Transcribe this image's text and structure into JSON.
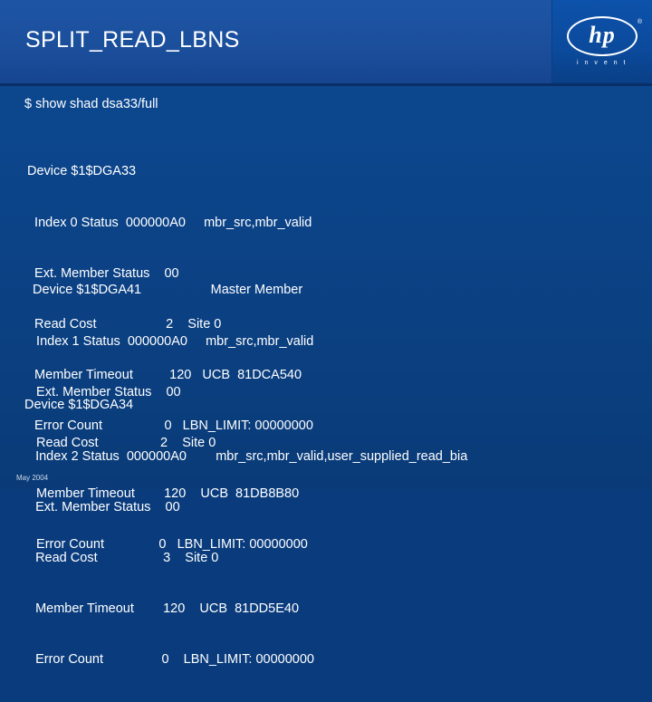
{
  "slide": {
    "title": "SPLIT_READ_LBNS",
    "prompt": "$ show shad dsa33/full",
    "footer_date": "May 2004",
    "logo": {
      "wordmark": "hp",
      "registered": "®",
      "tagline": "i n v e n t"
    },
    "blocks": [
      {
        "name": "device-dga33-block",
        "lines": [
          "Device $1$DGA33",
          "  Index 0 Status  000000A0     mbr_src,mbr_valid",
          "  Ext. Member Status    00",
          "  Read Cost                   2    Site 0",
          "  Member Timeout          120   UCB  81DCA540",
          "  Error Count                 0   LBN_LIMIT: 00000000"
        ]
      },
      {
        "name": "device-dga41-block",
        "lines": [
          " Device $1$DGA41                   Master Member",
          "  Index 1 Status  000000A0     mbr_src,mbr_valid",
          "  Ext. Member Status    00",
          "  Read Cost                 2    Site 0",
          "  Member Timeout        120    UCB  81DB8B80",
          "  Error Count               0   LBN_LIMIT: 00000000"
        ]
      },
      {
        "name": "device-dga34-block",
        "lines": [
          "Device $1$DGA34",
          "   Index 2 Status  000000A0        mbr_src,mbr_valid,user_supplied_read_bia",
          "   Ext. Member Status    00",
          "   Read Cost                  3    Site 0",
          "   Member Timeout        120    UCB  81DD5E40",
          "   Error Count                0    LBN_LIMIT: 00000000"
        ]
      }
    ]
  }
}
